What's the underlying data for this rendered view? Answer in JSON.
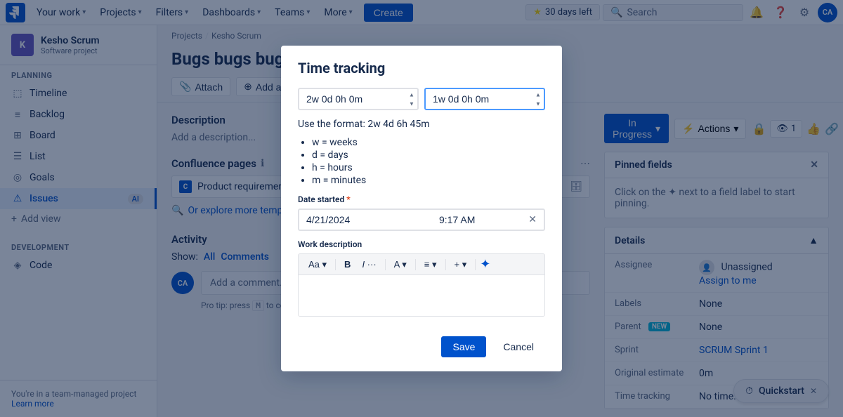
{
  "nav": {
    "logo_text": "J",
    "your_work": "Your work",
    "projects": "Projects",
    "filters": "Filters",
    "dashboards": "Dashboards",
    "teams": "Teams",
    "more": "More",
    "create": "Create",
    "trial": "30 days left",
    "search_placeholder": "Search",
    "help_icon": "?",
    "settings_icon": "⚙",
    "avatar": "CA"
  },
  "sidebar": {
    "project_icon": "K",
    "project_name": "Kesho Scrum",
    "project_type": "Software project",
    "planning_label": "PLANNING",
    "items": [
      {
        "id": "timeline",
        "label": "Timeline",
        "icon": "▤"
      },
      {
        "id": "backlog",
        "label": "Backlog",
        "icon": "≡"
      },
      {
        "id": "board",
        "label": "Board",
        "icon": "⊞"
      },
      {
        "id": "list",
        "label": "List",
        "icon": "☰"
      },
      {
        "id": "goals",
        "label": "Goals",
        "icon": "◎"
      },
      {
        "id": "issues",
        "label": "Issues",
        "icon": "⚠",
        "badge": "AI",
        "active": true
      }
    ],
    "add_view": "+ Add view",
    "dev_label": "DEVELOPMENT",
    "dev_items": [
      {
        "id": "code",
        "label": "Code",
        "icon": "◈"
      }
    ],
    "footer_line1": "You're in a team-managed project",
    "footer_link": "Learn more"
  },
  "breadcrumb": {
    "projects": "Projects",
    "project": "Kesho Scrum",
    "separator": "/"
  },
  "page": {
    "title": "Bugs bugs bugs"
  },
  "toolbar": {
    "attach": "Attach",
    "add_child": "Add a c..."
  },
  "status_bar": {
    "status": "In Progress",
    "actions": "Actions",
    "watch_count": "1",
    "icons": [
      "🔒",
      "👁",
      "👍",
      "🔗",
      "⋯"
    ]
  },
  "pinned": {
    "title": "Pinned fields",
    "body": "Click on the ✦ next to a field label to start pinning."
  },
  "details": {
    "title": "Details",
    "assignee_label": "Assignee",
    "assignee_value": "Unassigned",
    "assign_me": "Assign to me",
    "labels_label": "Labels",
    "labels_value": "None",
    "parent_label": "Parent",
    "parent_badge": "NEW",
    "parent_value": "None",
    "sprint_label": "Sprint",
    "sprint_value": "SCRUM Sprint 1",
    "original_label": "Original estimate",
    "original_value": "0m",
    "time_label": "Time tracking",
    "time_value": "No time..."
  },
  "description": {
    "title": "Description",
    "placeholder": "Add a description..."
  },
  "confluence": {
    "title": "Confluence pages",
    "item": "Product requirements",
    "explore": "Or explore more templ..."
  },
  "activity": {
    "title": "Activity",
    "show_label": "Show:",
    "all": "All",
    "comments": "Comments",
    "comment_placeholder": "Add a comment...",
    "pro_tip": "Pro tip: press",
    "key": "M",
    "tip_end": "to comment",
    "avatar": "CA"
  },
  "modal": {
    "title": "Time tracking",
    "time_spent_placeholder": "2w 0d 0h 0m",
    "time_remaining_placeholder": "1w 0d 0h 0m",
    "format_hint": "Use the format: 2w 4d 6h 45m",
    "format_items": [
      "w = weeks",
      "d = days",
      "h = hours",
      "m = minutes"
    ],
    "date_label": "Date started",
    "date_required": "*",
    "date_value": "4/21/2024",
    "time_value": "9:17 AM",
    "work_desc_label": "Work description",
    "editor_buttons": [
      "Aa",
      "B",
      "I",
      "···",
      "A",
      "≡",
      "+",
      "✦"
    ],
    "save_label": "Save",
    "cancel_label": "Cancel"
  },
  "quickstart": {
    "label": "Quickstart",
    "icon": "⏱"
  }
}
